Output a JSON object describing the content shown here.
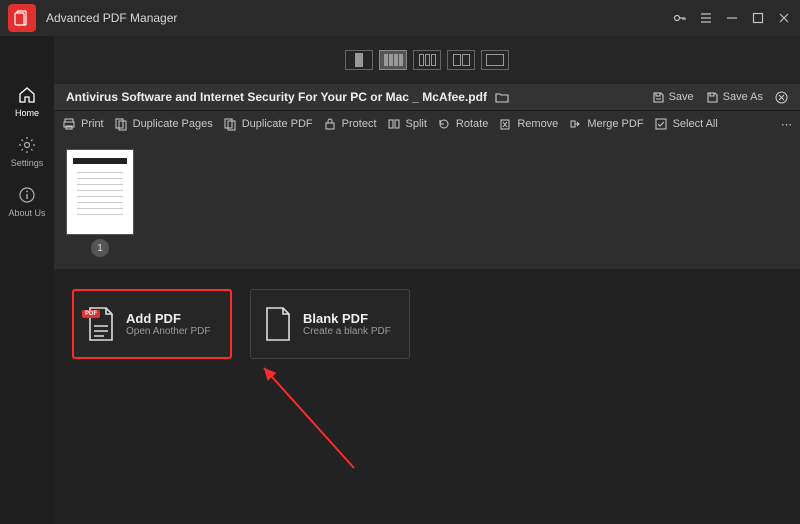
{
  "app": {
    "title": "Advanced PDF Manager"
  },
  "sidebar": {
    "items": [
      {
        "label": "Home"
      },
      {
        "label": "Settings"
      },
      {
        "label": "About Us"
      }
    ]
  },
  "doc": {
    "filename": "Antivirus Software and Internet Security For Your PC or Mac _ McAfee.pdf",
    "save": "Save",
    "saveas": "Save As"
  },
  "toolbar": {
    "print": "Print",
    "duplicate_pages": "Duplicate Pages",
    "duplicate_pdf": "Duplicate PDF",
    "protect": "Protect",
    "split": "Split",
    "rotate": "Rotate",
    "remove": "Remove",
    "merge": "Merge PDF",
    "select_all": "Select All"
  },
  "thumbs": {
    "pages": [
      "1"
    ]
  },
  "cards": {
    "add": {
      "title": "Add PDF",
      "sub": "Open Another PDF",
      "badge": "PDF"
    },
    "blank": {
      "title": "Blank PDF",
      "sub": "Create a blank PDF"
    }
  }
}
